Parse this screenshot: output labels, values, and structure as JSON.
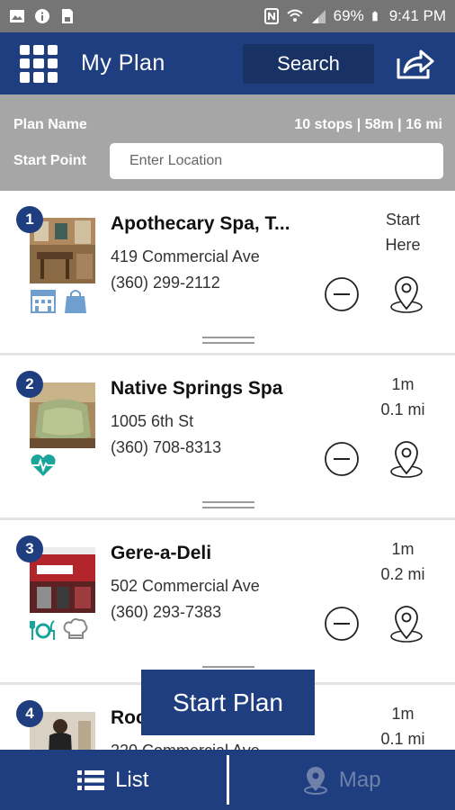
{
  "status_bar": {
    "battery": "69%",
    "time": "9:41 PM"
  },
  "app_bar": {
    "title": "My Plan",
    "search_label": "Search"
  },
  "plan": {
    "name_label": "Plan Name",
    "stats": "10 stops | 58m | 16 mi",
    "start_point_label": "Start Point",
    "start_point_placeholder": "Enter Location"
  },
  "stops": [
    {
      "number": "1",
      "name": "Apothecary Spa, T...",
      "address": "419 Commercial Ave",
      "phone": "(360) 299-2112",
      "dist_line1": "Start",
      "dist_line2": "Here",
      "categories": [
        "lodging-icon",
        "shopping-bag-icon"
      ]
    },
    {
      "number": "2",
      "name": "Native Springs Spa",
      "address": "1005 6th St",
      "phone": "(360) 708-8313",
      "dist_line1": "1m",
      "dist_line2": "0.1 mi",
      "categories": [
        "health-heart-icon"
      ]
    },
    {
      "number": "3",
      "name": "Gere-a-Deli",
      "address": "502 Commercial Ave",
      "phone": "(360) 293-7383",
      "dist_line1": "1m",
      "dist_line2": "0.2 mi",
      "categories": [
        "dining-icon",
        "chef-hat-icon"
      ]
    },
    {
      "number": "4",
      "name": "Roc",
      "address": "220 Commercial Ave",
      "phone": "",
      "dist_line1": "1m",
      "dist_line2": "0.1 mi",
      "categories": []
    }
  ],
  "start_plan_label": "Start Plan",
  "bottom_nav": {
    "list_label": "List",
    "map_label": "Map"
  },
  "colors": {
    "primary": "#1f3e80",
    "header_gray": "#a6a6a6",
    "category_blue": "#6e9fd0",
    "category_teal": "#1aa59a"
  }
}
